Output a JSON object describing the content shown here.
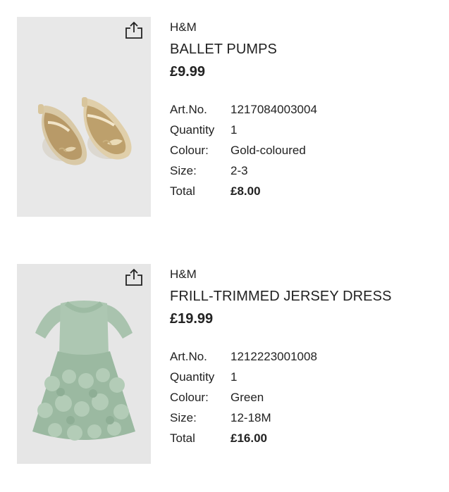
{
  "items": [
    {
      "brand": "H&M",
      "name": "BALLET PUMPS",
      "price": "£9.99",
      "image_icon": "gold-ballet-pumps-photo",
      "image_bg": "#e8e8e8",
      "specs": {
        "art_label": "Art.No.",
        "art_value": "1217084003004",
        "qty_label": "Quantity",
        "qty_value": "1",
        "colour_label": "Colour:",
        "colour_value": "Gold-coloured",
        "size_label": "Size:",
        "size_value": "2-3",
        "total_label": "Total",
        "total_value": "£8.00"
      }
    },
    {
      "brand": "H&M",
      "name": "FRILL-TRIMMED JERSEY DRESS",
      "price": "£19.99",
      "image_icon": "green-frill-dress-photo",
      "image_bg": "#e6e6e6",
      "specs": {
        "art_label": "Art.No.",
        "art_value": "1212223001008",
        "qty_label": "Quantity",
        "qty_value": "1",
        "colour_label": "Colour:",
        "colour_value": "Green",
        "size_label": "Size:",
        "size_value": "12-18M",
        "total_label": "Total",
        "total_value": "£16.00"
      }
    }
  ],
  "share_icon": "share-icon"
}
